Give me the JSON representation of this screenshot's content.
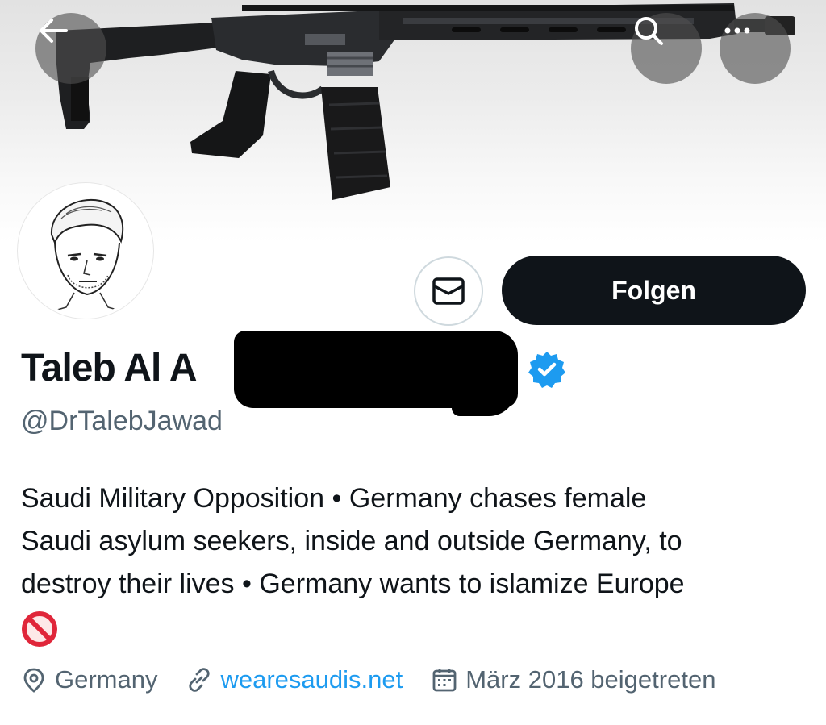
{
  "profile": {
    "display_name_visible": "Taleb Al A",
    "handle": "@DrTalebJawad",
    "verified_color": "#1d9bf0"
  },
  "actions": {
    "follow_label": "Folgen"
  },
  "bio": {
    "lines": [
      "Saudi Military Opposition • Germany chases female",
      "Saudi asylum seekers, inside and outside Germany, to",
      "destroy their lives • Germany wants to islamize Europe"
    ],
    "emoji": "prohibited-emoji"
  },
  "meta": {
    "location": "Germany",
    "website": "wearesaudis.net",
    "joined": "März 2016 beigetreten"
  },
  "icons": {
    "back": "arrow-left-icon",
    "search": "search-icon",
    "more": "more-icon",
    "message": "envelope-icon",
    "location": "location-pin-icon",
    "link": "link-icon",
    "calendar": "calendar-icon"
  },
  "colors": {
    "accent": "#1d9bf0",
    "follow_button": "#0f1419",
    "secondary_text": "#536471"
  }
}
